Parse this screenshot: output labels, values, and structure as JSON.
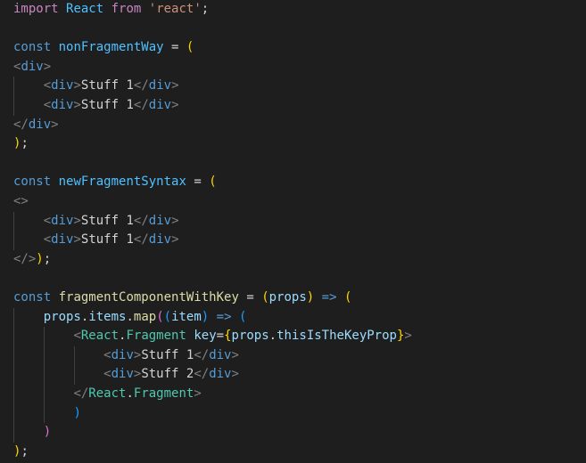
{
  "editor": {
    "lines": [
      [
        {
          "t": "import",
          "c": "imp"
        },
        {
          "t": " ",
          "c": "op"
        },
        {
          "t": "React",
          "c": "var"
        },
        {
          "t": " ",
          "c": "op"
        },
        {
          "t": "from",
          "c": "imp"
        },
        {
          "t": " ",
          "c": "op"
        },
        {
          "t": "'react'",
          "c": "str"
        },
        {
          "t": ";",
          "c": "op"
        }
      ],
      [],
      [
        {
          "t": "const",
          "c": "kw"
        },
        {
          "t": " ",
          "c": "op"
        },
        {
          "t": "nonFragmentWay",
          "c": "var"
        },
        {
          "t": " = ",
          "c": "op"
        },
        {
          "t": "(",
          "c": "b1"
        }
      ],
      [
        {
          "t": "<",
          "c": "tagp"
        },
        {
          "t": "div",
          "c": "tag"
        },
        {
          "t": ">",
          "c": "tagp"
        }
      ],
      [
        {
          "t": "    ",
          "c": "op"
        },
        {
          "t": "<",
          "c": "tagp"
        },
        {
          "t": "div",
          "c": "tag"
        },
        {
          "t": ">",
          "c": "tagp"
        },
        {
          "t": "Stuff 1",
          "c": "text"
        },
        {
          "t": "</",
          "c": "tagp"
        },
        {
          "t": "div",
          "c": "tag"
        },
        {
          "t": ">",
          "c": "tagp"
        }
      ],
      [
        {
          "t": "    ",
          "c": "op"
        },
        {
          "t": "<",
          "c": "tagp"
        },
        {
          "t": "div",
          "c": "tag"
        },
        {
          "t": ">",
          "c": "tagp"
        },
        {
          "t": "Stuff 1",
          "c": "text"
        },
        {
          "t": "</",
          "c": "tagp"
        },
        {
          "t": "div",
          "c": "tag"
        },
        {
          "t": ">",
          "c": "tagp"
        }
      ],
      [
        {
          "t": "</",
          "c": "tagp"
        },
        {
          "t": "div",
          "c": "tag"
        },
        {
          "t": ">",
          "c": "tagp"
        }
      ],
      [
        {
          "t": ")",
          "c": "b1"
        },
        {
          "t": ";",
          "c": "op"
        }
      ],
      [],
      [
        {
          "t": "const",
          "c": "kw"
        },
        {
          "t": " ",
          "c": "op"
        },
        {
          "t": "newFragmentSyntax",
          "c": "var"
        },
        {
          "t": " = ",
          "c": "op"
        },
        {
          "t": "(",
          "c": "b1"
        }
      ],
      [
        {
          "t": "<>",
          "c": "tagp"
        }
      ],
      [
        {
          "t": "    ",
          "c": "op"
        },
        {
          "t": "<",
          "c": "tagp"
        },
        {
          "t": "div",
          "c": "tag"
        },
        {
          "t": ">",
          "c": "tagp"
        },
        {
          "t": "Stuff 1",
          "c": "text"
        },
        {
          "t": "</",
          "c": "tagp"
        },
        {
          "t": "div",
          "c": "tag"
        },
        {
          "t": ">",
          "c": "tagp"
        }
      ],
      [
        {
          "t": "    ",
          "c": "op"
        },
        {
          "t": "<",
          "c": "tagp"
        },
        {
          "t": "div",
          "c": "tag"
        },
        {
          "t": ">",
          "c": "tagp"
        },
        {
          "t": "Stuff 1",
          "c": "text"
        },
        {
          "t": "</",
          "c": "tagp"
        },
        {
          "t": "div",
          "c": "tag"
        },
        {
          "t": ">",
          "c": "tagp"
        }
      ],
      [
        {
          "t": "</>",
          "c": "tagp"
        },
        {
          "t": ")",
          "c": "b1"
        },
        {
          "t": ";",
          "c": "op"
        }
      ],
      [],
      [
        {
          "t": "const",
          "c": "kw"
        },
        {
          "t": " ",
          "c": "op"
        },
        {
          "t": "fragmentComponentWithKey",
          "c": "fn"
        },
        {
          "t": " = ",
          "c": "op"
        },
        {
          "t": "(",
          "c": "b1"
        },
        {
          "t": "props",
          "c": "param"
        },
        {
          "t": ")",
          "c": "b1"
        },
        {
          "t": " => ",
          "c": "kw"
        },
        {
          "t": "(",
          "c": "b1"
        }
      ],
      [
        {
          "t": "    ",
          "c": "op"
        },
        {
          "t": "props",
          "c": "prop"
        },
        {
          "t": ".",
          "c": "op"
        },
        {
          "t": "items",
          "c": "prop"
        },
        {
          "t": ".",
          "c": "op"
        },
        {
          "t": "map",
          "c": "fn"
        },
        {
          "t": "(",
          "c": "b2"
        },
        {
          "t": "(",
          "c": "b3"
        },
        {
          "t": "item",
          "c": "param"
        },
        {
          "t": ")",
          "c": "b3"
        },
        {
          "t": " => ",
          "c": "kw"
        },
        {
          "t": "(",
          "c": "b3"
        }
      ],
      [
        {
          "t": "        ",
          "c": "op"
        },
        {
          "t": "<",
          "c": "tagp"
        },
        {
          "t": "React",
          "c": "comp"
        },
        {
          "t": ".",
          "c": "op"
        },
        {
          "t": "Fragment",
          "c": "comp"
        },
        {
          "t": " ",
          "c": "op"
        },
        {
          "t": "key",
          "c": "attr"
        },
        {
          "t": "=",
          "c": "op"
        },
        {
          "t": "{",
          "c": "b1"
        },
        {
          "t": "props",
          "c": "prop"
        },
        {
          "t": ".",
          "c": "op"
        },
        {
          "t": "thisIsTheKeyProp",
          "c": "prop"
        },
        {
          "t": "}",
          "c": "b1"
        },
        {
          "t": ">",
          "c": "tagp"
        }
      ],
      [
        {
          "t": "            ",
          "c": "op"
        },
        {
          "t": "<",
          "c": "tagp"
        },
        {
          "t": "div",
          "c": "tag"
        },
        {
          "t": ">",
          "c": "tagp"
        },
        {
          "t": "Stuff 1",
          "c": "text"
        },
        {
          "t": "</",
          "c": "tagp"
        },
        {
          "t": "div",
          "c": "tag"
        },
        {
          "t": ">",
          "c": "tagp"
        }
      ],
      [
        {
          "t": "            ",
          "c": "op"
        },
        {
          "t": "<",
          "c": "tagp"
        },
        {
          "t": "div",
          "c": "tag"
        },
        {
          "t": ">",
          "c": "tagp"
        },
        {
          "t": "Stuff 2",
          "c": "text"
        },
        {
          "t": "</",
          "c": "tagp"
        },
        {
          "t": "div",
          "c": "tag"
        },
        {
          "t": ">",
          "c": "tagp"
        }
      ],
      [
        {
          "t": "        ",
          "c": "op"
        },
        {
          "t": "</",
          "c": "tagp"
        },
        {
          "t": "React",
          "c": "comp"
        },
        {
          "t": ".",
          "c": "op"
        },
        {
          "t": "Fragment",
          "c": "comp"
        },
        {
          "t": ">",
          "c": "tagp"
        }
      ],
      [
        {
          "t": "        ",
          "c": "op"
        },
        {
          "t": ")",
          "c": "b3"
        }
      ],
      [
        {
          "t": "    ",
          "c": "op"
        },
        {
          "t": ")",
          "c": "b2"
        }
      ],
      [
        {
          "t": ")",
          "c": "b1"
        },
        {
          "t": ";",
          "c": "op"
        }
      ]
    ]
  }
}
